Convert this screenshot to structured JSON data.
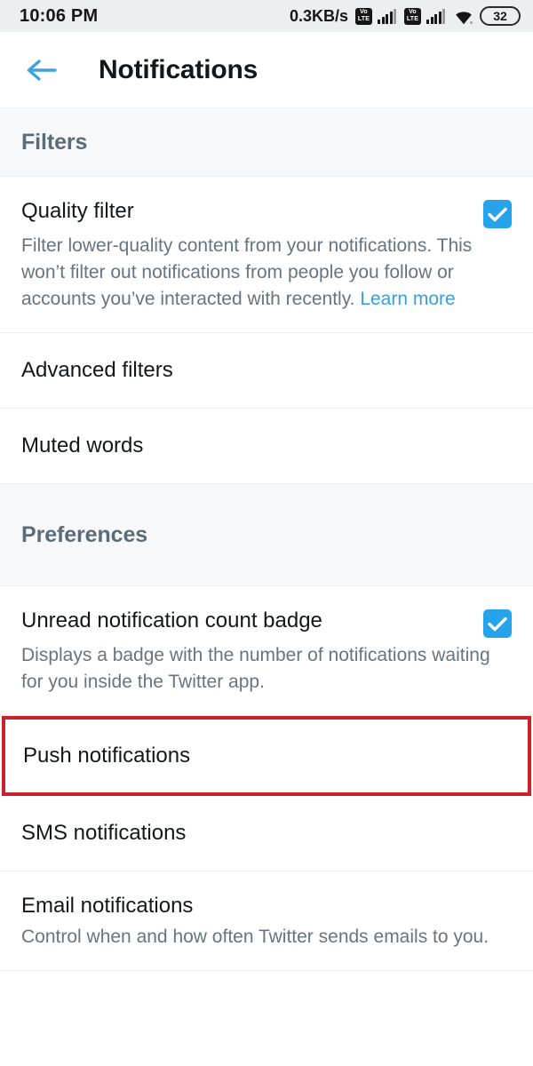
{
  "status_bar": {
    "time": "10:06 PM",
    "network_speed": "0.3KB/s",
    "volte_top": "Vo",
    "volte_bottom": "LTE",
    "battery_level": "32",
    "icons": [
      "volte-icon",
      "signal-bars-icon",
      "volte-icon",
      "signal-bars-icon",
      "wifi-icon",
      "battery-icon"
    ]
  },
  "app_bar": {
    "back_icon": "back-arrow-icon",
    "title": "Notifications"
  },
  "sections": [
    {
      "title": "Filters",
      "rows": [
        {
          "title": "Quality filter",
          "description": "Filter lower-quality content from your notifications. This won’t filter out notifications from people you follow or accounts you’ve interacted with recently.",
          "link_label": "Learn more",
          "checked": true
        },
        {
          "title": "Advanced filters"
        },
        {
          "title": "Muted words"
        }
      ]
    },
    {
      "title": "Preferences",
      "rows": [
        {
          "title": "Unread notification count badge",
          "description": "Displays a badge with the number of notifications waiting for you inside the Twitter app.",
          "checked": true
        },
        {
          "title": "Push notifications",
          "highlighted": true
        },
        {
          "title": "SMS notifications"
        },
        {
          "title": "Email notifications",
          "description": "Control when and how often Twitter sends emails to you."
        }
      ]
    }
  ],
  "colors": {
    "accent": "#27a3eb",
    "link": "#3a9fd8",
    "highlight": "#c8232c",
    "section_bg": "#f6f8f9",
    "section_text": "#5b6b78",
    "primary_text": "#14171a",
    "secondary_text": "#667580"
  }
}
